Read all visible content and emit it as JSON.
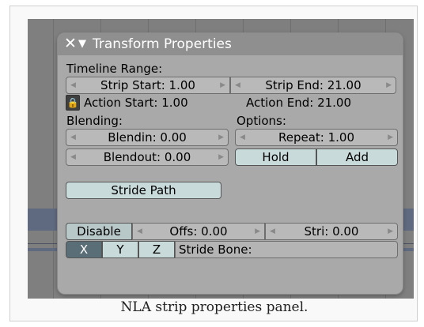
{
  "panel": {
    "title": "Transform Properties",
    "close_glyph": "✕",
    "collapse_glyph": "▼"
  },
  "timeline": {
    "heading": "Timeline Range:",
    "strip_start": "Strip Start: 1.00",
    "strip_end": "Strip End: 21.00",
    "action_start": "Action Start: 1.00",
    "action_end": "Action End: 21.00"
  },
  "blending": {
    "heading": "Blending:",
    "blendin": "Blendin: 0.00",
    "blendout": "Blendout: 0.00"
  },
  "options": {
    "heading": "Options:",
    "repeat": "Repeat: 1.00",
    "hold": "Hold",
    "add": "Add"
  },
  "stride": {
    "stride_path": "Stride Path",
    "disable": "Disable",
    "offs": "Offs: 0.00",
    "stri": "Stri: 0.00",
    "x": "X",
    "y": "Y",
    "z": "Z",
    "stride_bone": "Stride Bone:"
  },
  "caption": "NLA strip properties panel."
}
